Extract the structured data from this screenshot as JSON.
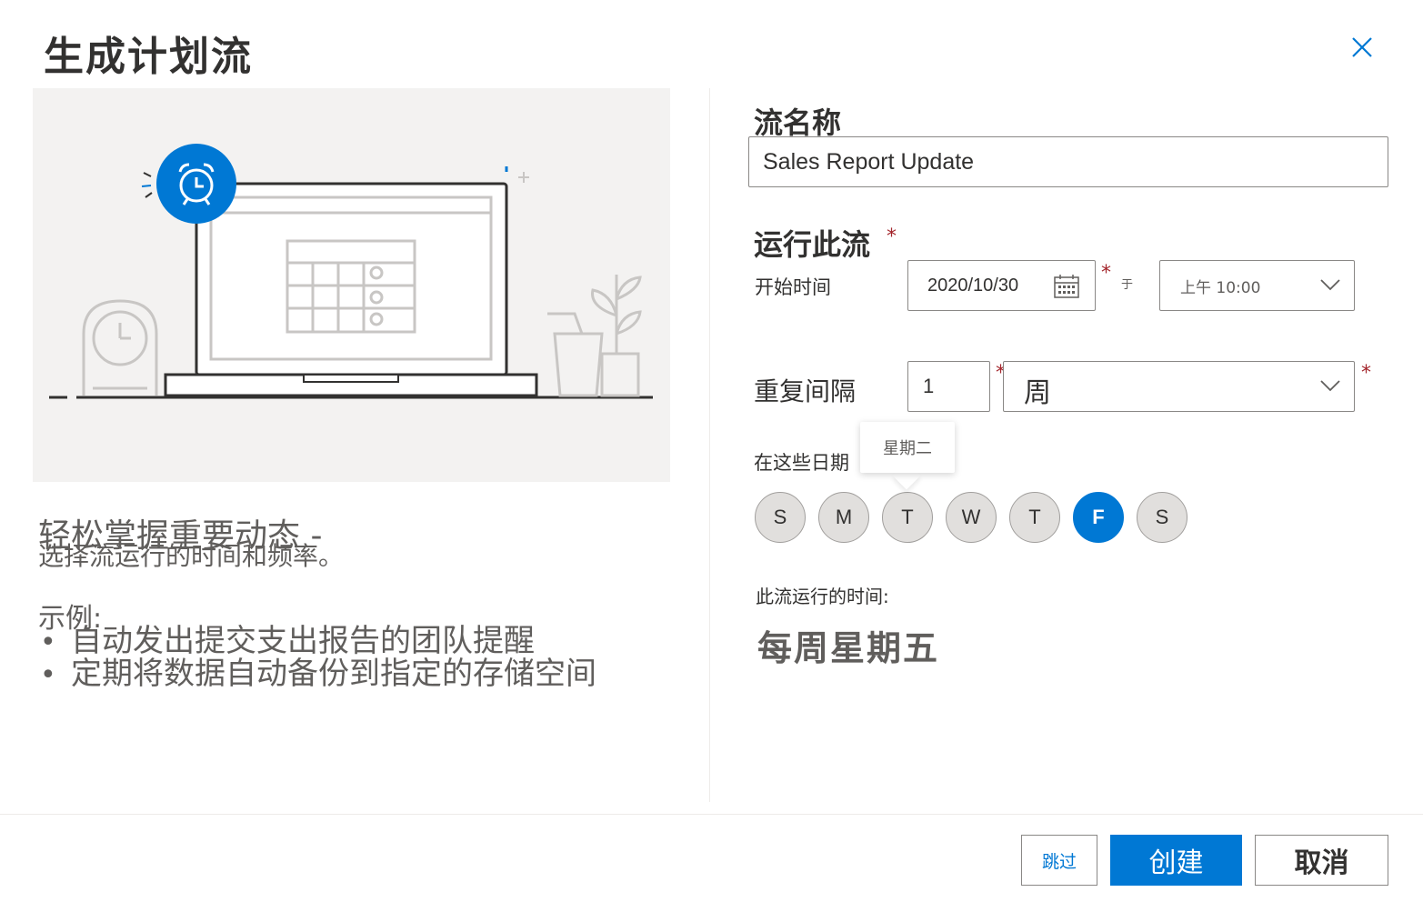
{
  "dialog": {
    "title": "生成计划流"
  },
  "intro": {
    "heading": "轻松掌握重要动态 -",
    "subheading": "选择流运行的时间和频率。",
    "examples_label": "示例:",
    "examples": [
      "自动发出提交支出报告的团队提醒",
      "定期将数据自动备份到指定的存储空间"
    ]
  },
  "form": {
    "flow_name_label": "流名称",
    "flow_name_value": "Sales Report Update",
    "run_label": "运行此流",
    "required_mark": "*",
    "start_label": "开始时间",
    "start_date": "2020/10/30",
    "at_label": "于",
    "start_time": "上午 10:00",
    "repeat_label": "重复间隔",
    "repeat_value": "1",
    "repeat_unit": "周",
    "days_label": "在这些日期",
    "days": [
      "S",
      "M",
      "T",
      "W",
      "T",
      "F",
      "S"
    ],
    "selected_day_index": 5,
    "tooltip": "星期二",
    "runs_label": "此流运行的时间:",
    "runs_value": "每周星期五"
  },
  "footer": {
    "skip_label": "跳过",
    "create_label": "创建",
    "cancel_label": "取消"
  },
  "colors": {
    "accent": "#0078d4",
    "required": "#a4262c",
    "illustration_bg": "#f3f2f1"
  }
}
